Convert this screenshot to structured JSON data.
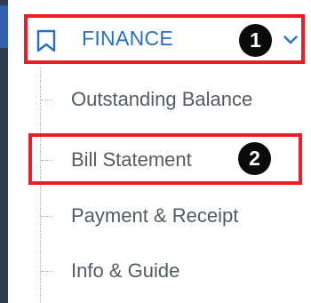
{
  "menu": {
    "title": "FINANCE",
    "icon": "bookmark-icon",
    "expand_icon": "chevron-down-icon",
    "items": [
      {
        "label": "Outstanding Balance"
      },
      {
        "label": "Bill Statement"
      },
      {
        "label": "Payment & Receipt"
      },
      {
        "label": "Info & Guide"
      }
    ]
  },
  "annotations": [
    {
      "number": "1"
    },
    {
      "number": "2"
    }
  ],
  "colors": {
    "accent": "#2a6fc0",
    "highlight": "#ee1c25",
    "badge": "#0b0b0b",
    "sidebar": "#2f3b4f"
  }
}
